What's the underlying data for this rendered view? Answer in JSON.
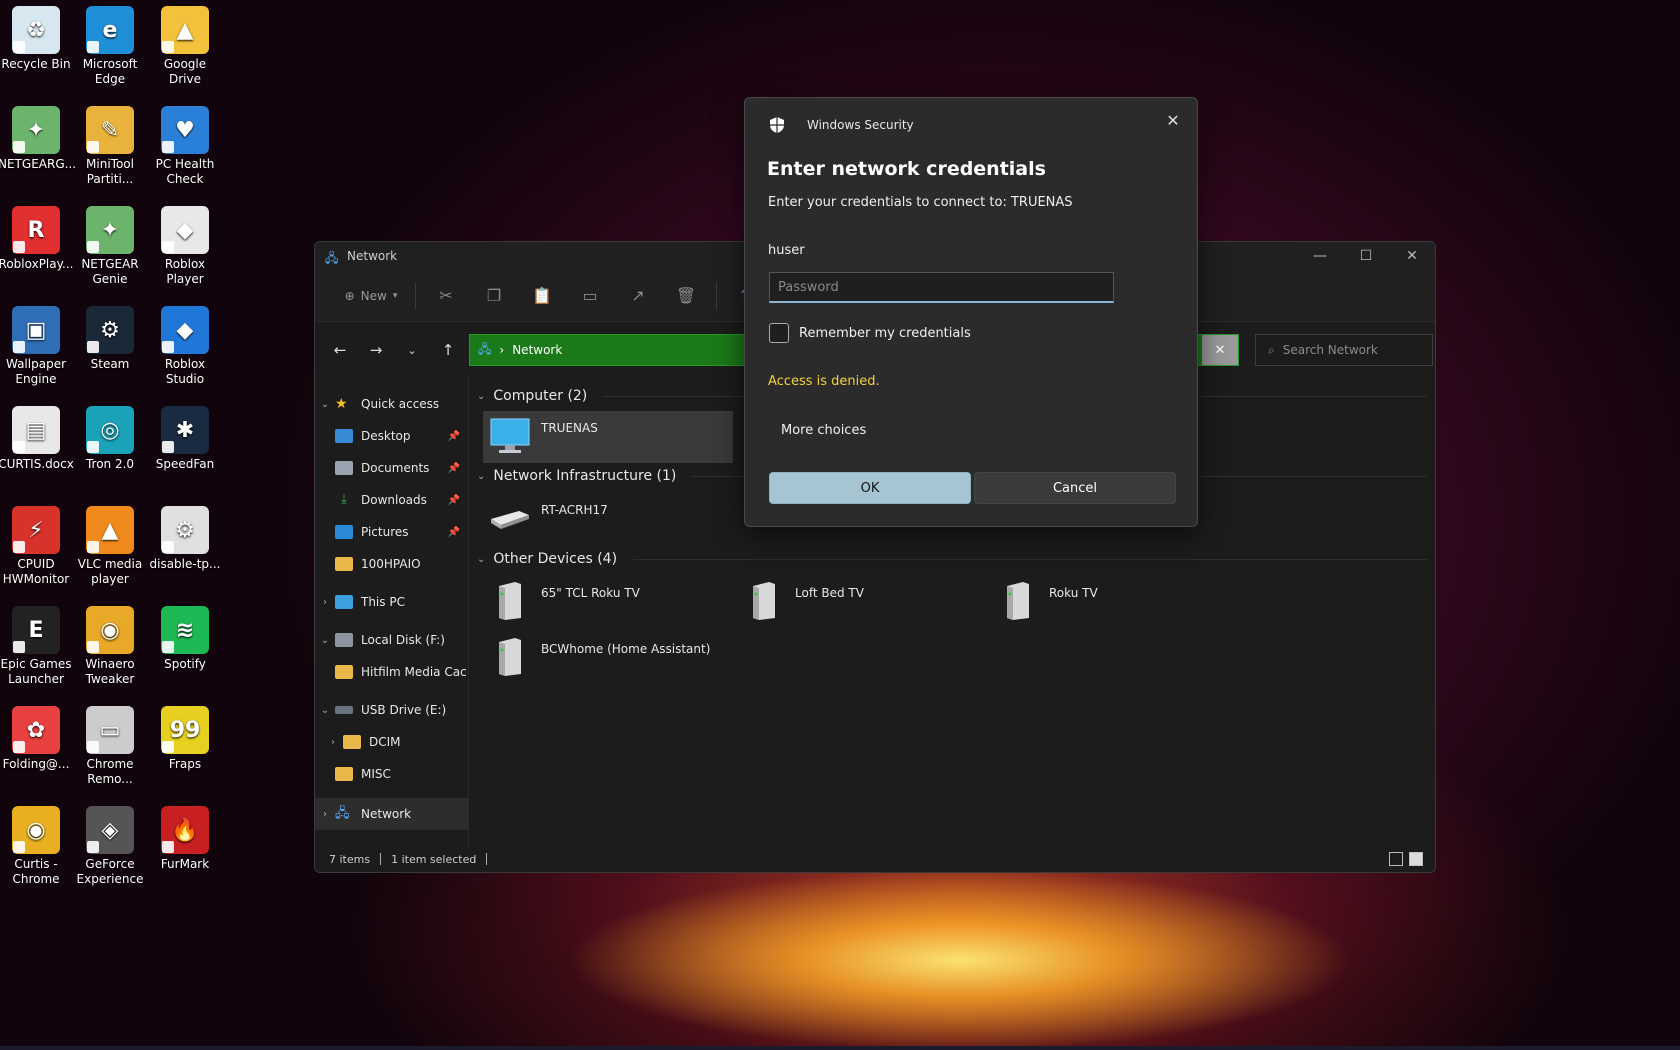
{
  "desktop": {
    "icons": [
      {
        "label": "Recycle Bin",
        "color": "#d7e7f0",
        "glyph": "♻"
      },
      {
        "label": "Microsoft Edge",
        "color": "#1f8fd8",
        "glyph": "e"
      },
      {
        "label": "Google Drive",
        "color": "#f3c13a",
        "glyph": "▲"
      },
      {
        "label": "NETGEARG...",
        "color": "#6cb36c",
        "glyph": "✦"
      },
      {
        "label": "MiniTool Partiti...",
        "color": "#e9b23c",
        "glyph": "✎"
      },
      {
        "label": "PC Health Check",
        "color": "#2a7fd8",
        "glyph": "♥"
      },
      {
        "label": "RobloxPlay...",
        "color": "#e23030",
        "glyph": "R"
      },
      {
        "label": "NETGEAR Genie",
        "color": "#6cb36c",
        "glyph": "✦"
      },
      {
        "label": "Roblox Player",
        "color": "#e8e8e8",
        "glyph": "◆"
      },
      {
        "label": "Wallpaper Engine",
        "color": "#2f6fb8",
        "glyph": "▣"
      },
      {
        "label": "Steam",
        "color": "#1b2838",
        "glyph": "⚙"
      },
      {
        "label": "Roblox Studio",
        "color": "#1f78d8",
        "glyph": "◆"
      },
      {
        "label": "CURTIS.docx",
        "color": "#e8e8e8",
        "glyph": "▤"
      },
      {
        "label": "Tron 2.0",
        "color": "#1aa3b8",
        "glyph": "◎"
      },
      {
        "label": "SpeedFan",
        "color": "#1a2a40",
        "glyph": "✱"
      },
      {
        "label": "CPUID HWMonitor",
        "color": "#d8322c",
        "glyph": "⚡"
      },
      {
        "label": "VLC media player",
        "color": "#f08a1c",
        "glyph": "▲"
      },
      {
        "label": "disable-tp...",
        "color": "#e0e0e0",
        "glyph": "⚙"
      },
      {
        "label": "Epic Games Launcher",
        "color": "#222",
        "glyph": "E"
      },
      {
        "label": "Winaero Tweaker",
        "color": "#e8a828",
        "glyph": "◉"
      },
      {
        "label": "Spotify",
        "color": "#1db954",
        "glyph": "≋"
      },
      {
        "label": "Folding@...",
        "color": "#e84040",
        "glyph": "✿"
      },
      {
        "label": "Chrome Remo...",
        "color": "#ccc",
        "glyph": "▭"
      },
      {
        "label": "Fraps",
        "color": "#e8d020",
        "glyph": "99"
      },
      {
        "label": "Curtis - Chrome",
        "color": "#e8b020",
        "glyph": "◉"
      },
      {
        "label": "GeForce Experience",
        "color": "#555",
        "glyph": "◈"
      },
      {
        "label": "FurMark",
        "color": "#c82020",
        "glyph": "🔥"
      }
    ]
  },
  "explorer": {
    "title": "Network",
    "toolbar": {
      "new_label": "New"
    },
    "address": {
      "location": "Network"
    },
    "search": {
      "placeholder": "Search Network"
    },
    "nav": {
      "quick_access": "Quick access",
      "desktop": "Desktop",
      "documents": "Documents",
      "downloads": "Downloads",
      "pictures": "Pictures",
      "folder_100hpaio": "100HPAIO",
      "this_pc": "This PC",
      "local_disk": "Local Disk (F:)",
      "hitfilm": "Hitfilm Media Cac",
      "usb_drive": "USB Drive (E:)",
      "dcim": "DCIM",
      "misc": "MISC",
      "network": "Network"
    },
    "groups": {
      "computer": "Computer (2)",
      "infrastructure": "Network Infrastructure (1)",
      "other": "Other Devices (4)"
    },
    "items": {
      "truenas": "TRUENAS",
      "router": "RT-ACRH17",
      "tcl": "65\" TCL Roku TV",
      "loft": "Loft Bed TV",
      "roku": "Roku TV",
      "bcw": "BCWhome (Home Assistant)"
    },
    "status": {
      "items": "7 items",
      "selected": "1 item selected"
    }
  },
  "dialog": {
    "app_name": "Windows Security",
    "title": "Enter network credentials",
    "subtitle": "Enter your credentials to connect to: TRUENAS",
    "username": "huser",
    "password_placeholder": "Password",
    "remember_label": "Remember my credentials",
    "error": "Access is denied.",
    "more_choices": "More choices",
    "ok_label": "OK",
    "cancel_label": "Cancel"
  }
}
